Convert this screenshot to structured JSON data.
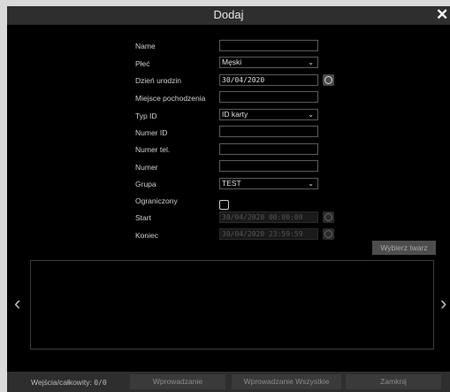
{
  "dialog": {
    "title": "Dodaj"
  },
  "form": {
    "name": {
      "label": "Name",
      "value": ""
    },
    "gender": {
      "label": "Płeć",
      "value": "Męski"
    },
    "birthdate": {
      "label": "Dzień urodzin",
      "value": "30/04/2020"
    },
    "birthplace": {
      "label": "Miejsce pochodzenia",
      "value": ""
    },
    "id_type": {
      "label": "Typ ID",
      "value": "ID karty"
    },
    "id_number": {
      "label": "Numer ID",
      "value": ""
    },
    "phone": {
      "label": "Numer tel.",
      "value": ""
    },
    "number": {
      "label": "Numer",
      "value": ""
    },
    "group": {
      "label": "Grupa",
      "value": "TEST"
    },
    "limited": {
      "label": "Ograniczony",
      "checked": false
    },
    "start": {
      "label": "Start",
      "value": "30/04/2020 00:00:00"
    },
    "end": {
      "label": "Koniec",
      "value": "30/04/2020 23:59:59"
    }
  },
  "buttons": {
    "pick_face": "Wybierz twarz",
    "import": "Wprowadzanie",
    "import_all": "Wprowadzanie Wszystkie",
    "close": "Zamknij"
  },
  "footer": {
    "count_label": "Wejścia/całkowity:",
    "count_value": "0/0"
  },
  "icons": {
    "close": "close-icon",
    "clock": "clock-icon",
    "chevron": "chevron-down-icon",
    "prev": "chevron-left-icon",
    "next": "chevron-right-icon"
  },
  "colors": {
    "background": "#000000",
    "bar": "#2e2e2e",
    "button": "#3a3a3a"
  }
}
